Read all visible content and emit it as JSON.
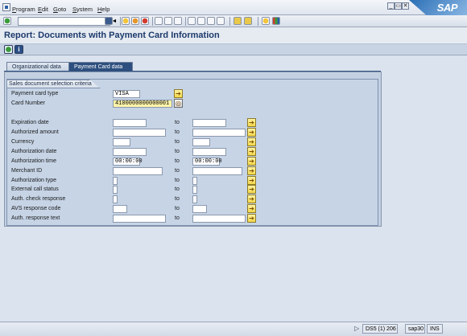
{
  "menubar": {
    "items": [
      "Program",
      "Edit",
      "Goto",
      "System",
      "Help"
    ],
    "logo": "SAP"
  },
  "window": {
    "minimize": "_",
    "restore": "▭",
    "close": "✕"
  },
  "toolbar": {
    "command_field_value": ""
  },
  "header": {
    "title": "Report: Documents with Payment Card Information"
  },
  "tabs": [
    {
      "label": "Organizational data"
    },
    {
      "label": "Payment Card data"
    }
  ],
  "group": {
    "title": "Sales document selection criteria",
    "payment_card_type": {
      "label": "Payment card type",
      "value": "VISA"
    },
    "card_number": {
      "label": "Card Number",
      "value": "4100000000000001"
    },
    "to_label": "to",
    "ranges": [
      {
        "label": "Expiration date",
        "low": "",
        "high": ""
      },
      {
        "label": "Authorized amount",
        "low": "",
        "high": ""
      },
      {
        "label": "Currency",
        "low": "",
        "high": ""
      },
      {
        "label": "Authorization date",
        "low": "",
        "high": ""
      },
      {
        "label": "Authorization time",
        "low": "00:00:00",
        "high": "00:00:00"
      },
      {
        "label": "Merchant ID",
        "low": "",
        "high": ""
      },
      {
        "label": "Authorization type",
        "low": "",
        "high": ""
      },
      {
        "label": "External call status",
        "low": "",
        "high": ""
      },
      {
        "label": "Auth. check response",
        "low": "",
        "high": ""
      },
      {
        "label": "AVS response code",
        "low": "",
        "high": ""
      },
      {
        "label": "Auth. response text",
        "low": "",
        "high": ""
      }
    ]
  },
  "statusbar": {
    "system": "DS5 (1) 206",
    "server": "sap30",
    "mode": "INS"
  },
  "colors": {
    "accent": "#2d4f7f",
    "required_field": "#fff4a8",
    "title": "#1c3a6b"
  },
  "icons": [
    "app-menu-icon",
    "enter-icon",
    "save-icon",
    "back-icon",
    "exit-icon",
    "cancel-icon",
    "print-icon",
    "find-icon",
    "find-next-icon",
    "first-page-icon",
    "prev-page-icon",
    "next-page-icon",
    "last-page-icon",
    "new-session-icon",
    "shortcut-icon",
    "help-icon",
    "layout-icon",
    "execute-icon",
    "info-icon",
    "multiple-selection-icon"
  ]
}
